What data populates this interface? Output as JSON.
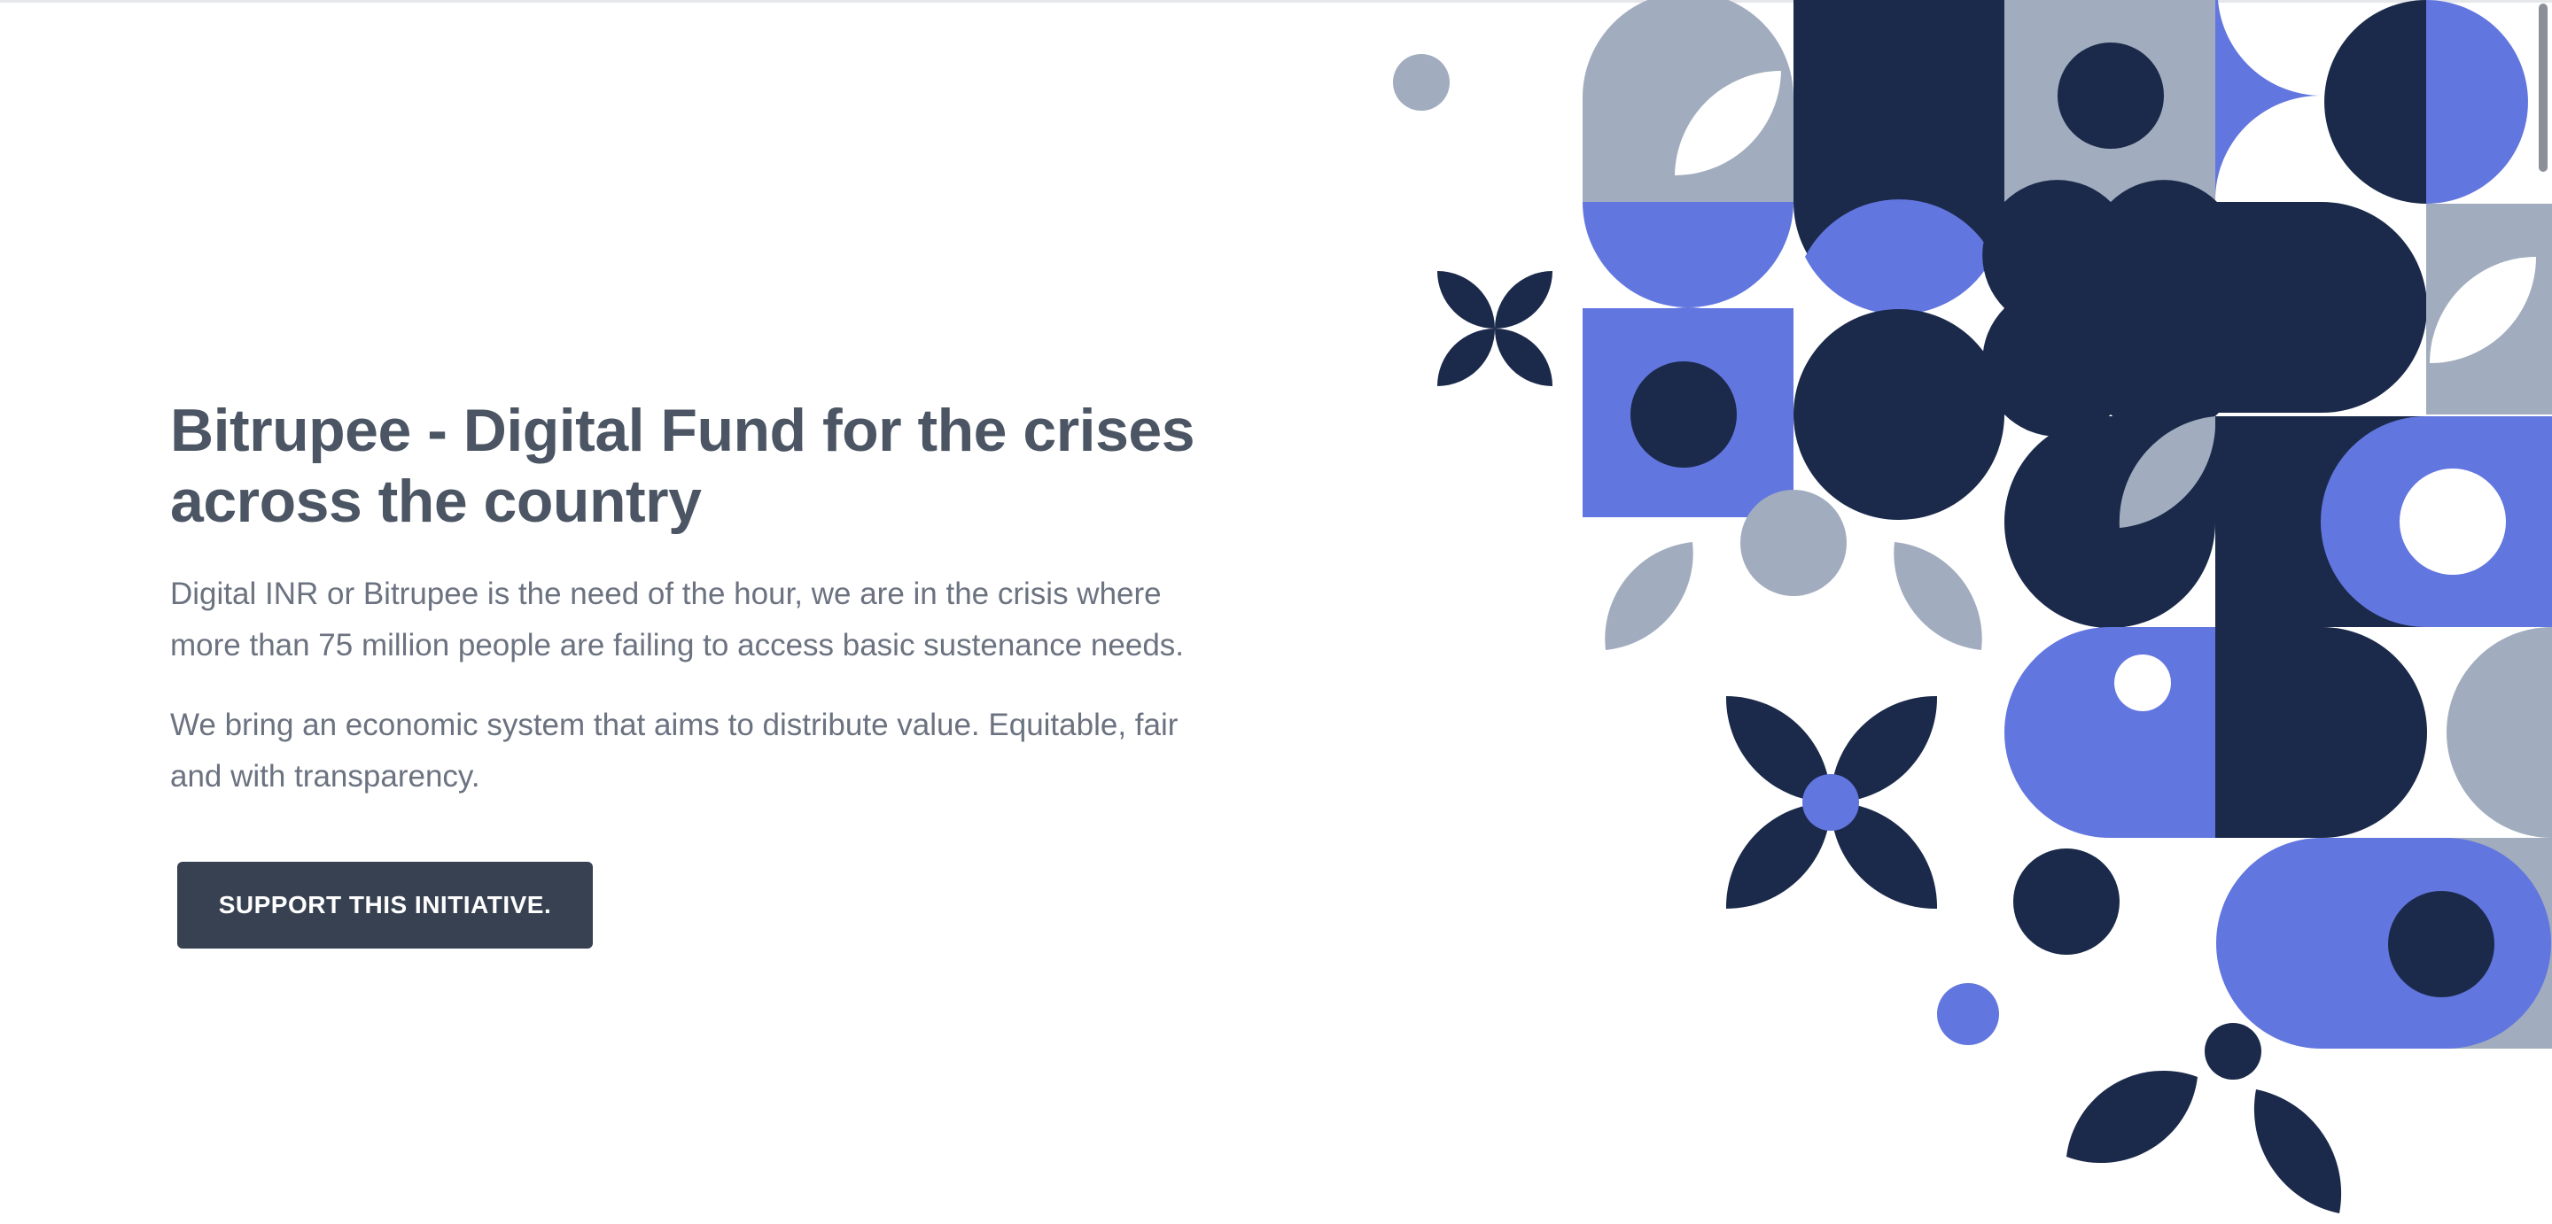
{
  "hero": {
    "title": "Bitrupee - Digital Fund for the crises across the country",
    "paragraph_1": "Digital INR or Bitrupee is the need of the hour, we are in the crisis where more than 75 million people are failing to access basic sustenance needs.",
    "paragraph_2": "We bring an economic system that aims to distribute value. Equitable, fair and with transparency.",
    "cta_label": "SUPPORT THIS INITIATIVE."
  },
  "illustration": {
    "name": "geometric-pattern-illustration",
    "colors": {
      "navy": "#1b2a4a",
      "blue": "#6276df",
      "gray": "#a1adbe",
      "white": "#ffffff"
    }
  },
  "theme": {
    "heading_color": "#4b5563",
    "text_color": "#6b7280",
    "button_color": "#374151"
  }
}
